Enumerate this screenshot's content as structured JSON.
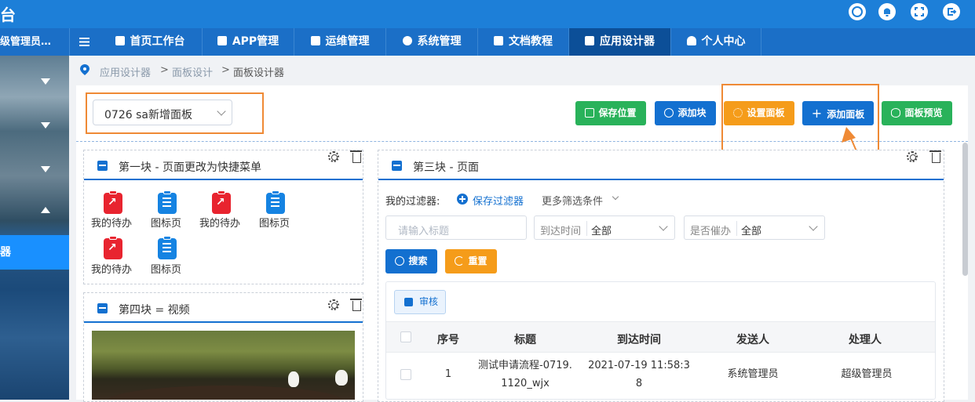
{
  "app": {
    "title_fragment": "台"
  },
  "topbar": {
    "icons": [
      "shuffle-icon",
      "bell-icon",
      "fullscreen-icon",
      "logout-icon"
    ]
  },
  "nav": {
    "user": "级管理员…",
    "tabs": [
      {
        "label": "首页工作台",
        "icon": "home-icon"
      },
      {
        "label": "APP管理",
        "icon": "phone-icon"
      },
      {
        "label": "运维管理",
        "icon": "tool-icon"
      },
      {
        "label": "系统管理",
        "icon": "gear-icon"
      },
      {
        "label": "文档教程",
        "icon": "doc-icon"
      },
      {
        "label": "应用设计器",
        "icon": "bank-icon",
        "active": true
      },
      {
        "label": "个人中心",
        "icon": "user-icon"
      }
    ]
  },
  "sidebar": {
    "active_item": "器"
  },
  "breadcrumb": {
    "items": [
      "应用设计器",
      "面板设计",
      "面板设计器"
    ],
    "separator": ">"
  },
  "toolbar": {
    "panel_select": "0726 sa新增面板",
    "buttons": {
      "save_position": "保存位置",
      "add_block": "添加块",
      "settings_panel": "设置面板",
      "add_panel": "添加面板",
      "preview_panel": "面板预览"
    }
  },
  "block1": {
    "title": "第一块 - 页面更改为快捷菜单",
    "items": [
      "我的待办",
      "图标页",
      "我的待办",
      "图标页",
      "我的待办",
      "图标页"
    ]
  },
  "block4": {
    "title": "第四块 = 视频"
  },
  "block3": {
    "title": "第三块 - 页面",
    "filter_label": "我的过滤器:",
    "save_filter": "保存过滤器",
    "more_filters": "更多筛选条件",
    "title_placeholder": "请输入标题",
    "arrival_label": "到达时间",
    "arrival_value": "全部",
    "urged_label": "是否催办",
    "urged_value": "全部",
    "search_button": "搜索",
    "reset_button": "重置",
    "review_button": "审核",
    "columns": [
      "序号",
      "标题",
      "到达时间",
      "发送人",
      "处理人"
    ],
    "rows": [
      {
        "index": "1",
        "title_line1": "测试申请流程-0719.",
        "title_line2": "1120_wjx",
        "time_line1": "2021-07-19 11:58:3",
        "time_line2": "8",
        "sender": "系统管理员",
        "handler": "超级管理员"
      }
    ]
  },
  "colors": {
    "primary": "#1370d0",
    "green": "#29b25a",
    "orange": "#f59c1a",
    "highlight": "#ef8a35"
  }
}
